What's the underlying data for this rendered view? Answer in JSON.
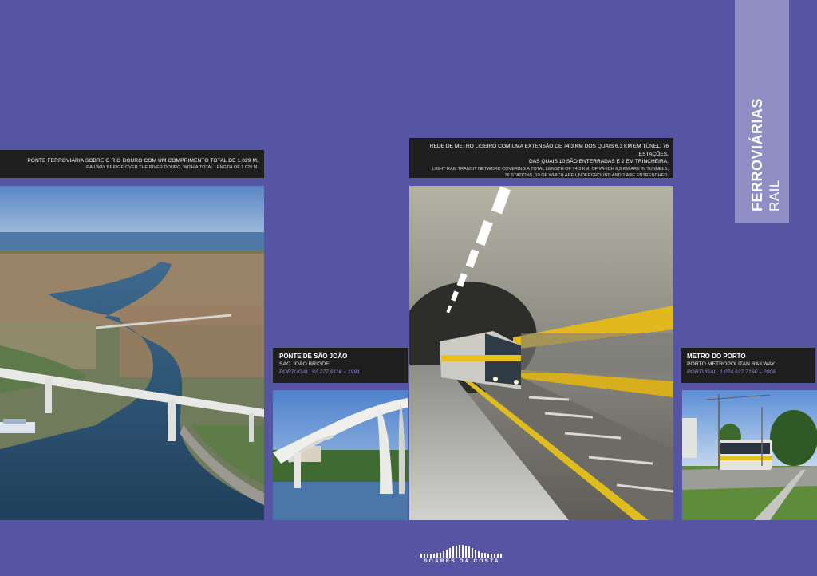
{
  "side_tab": {
    "title_pt": "FERROVIÁRIAS",
    "title_en": "RAIL"
  },
  "douro_bridge": {
    "caption_pt": "PONTE FERROVIÁRIA SOBRE O RIO DOURO COM UM COMPRIMENTO TOTAL DE 1.029 M.",
    "caption_en": "RAILWAY BRIDGE OVER THE RIVER DOURO, WITH A TOTAL LENGTH OF 1.029 M."
  },
  "sao_joao": {
    "title": "PONTE DE SÃO JOÃO",
    "subtitle": "SÃO JOÃO BRIGDE",
    "details": "PORTUGAL, 92.277.611€ – 1991"
  },
  "metro_network": {
    "caption_pt_1": "REDE DE METRO LIGEIRO COM UMA EXTENSÃO DE 74,3 KM DOS QUAIS 6,3 KM EM TÚNEL; 76 ESTAÇÕES,",
    "caption_pt_2": "DAS QUAIS 10 SÃO ENTERRADAS E 2 EM TRINCHEIRA.",
    "caption_en_1": "LIGHT RAIL TRANSIT NETWORK COVERING A TOTAL LENGTH OF 74,3 KM, OF WHICH 6,3 KM ARE IN TUNNELS;",
    "caption_en_2": "76 STATIONS, 10 OF WHICH ARE UNDERGROUND AND 2 ARE ENTRENCHED."
  },
  "metro_porto": {
    "title": "METRO DO PORTO",
    "subtitle": "PORTO METROPOLITAN RAILWAY",
    "details": "PORTUGAL, 1.074.627.716€ – 2006"
  },
  "logo": {
    "name": "SOARES DA COSTA"
  },
  "colors": {
    "background": "#5555a4",
    "tab": "#8f8fc6",
    "caption_bg": "#1e1e1e",
    "accent": "#8f8fd8"
  }
}
